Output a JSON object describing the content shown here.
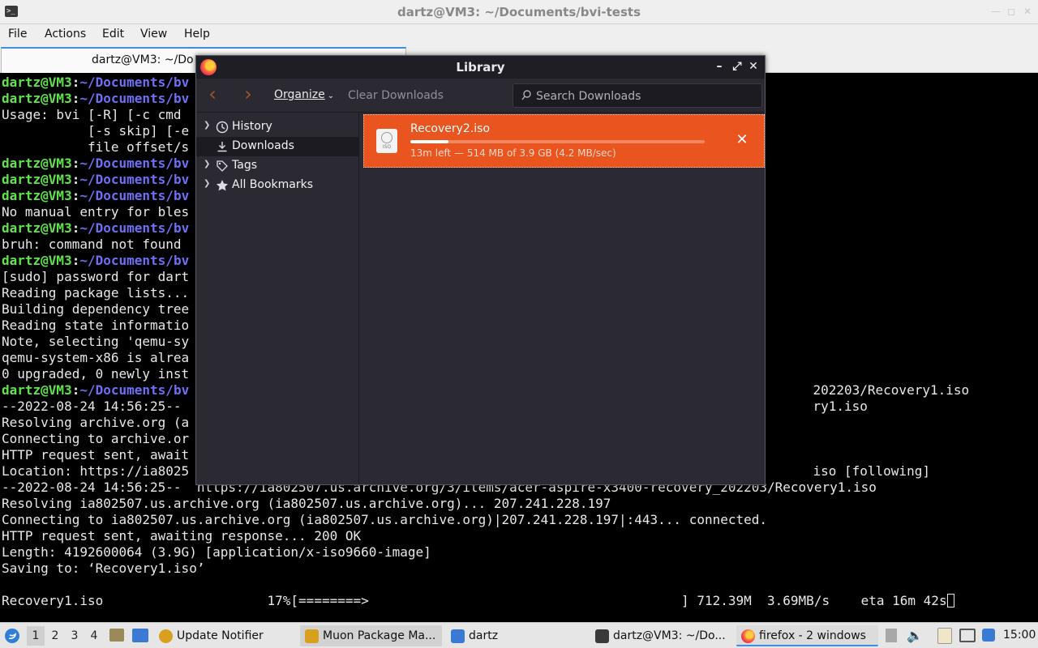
{
  "terminal": {
    "title": "dartz@VM3: ~/Documents/bvi-tests",
    "menu": [
      "File",
      "Actions",
      "Edit",
      "View",
      "Help"
    ],
    "tab_title": "dartz@VM3: ~/Do",
    "prompt_user": "dartz@VM3",
    "prompt_path": "~/Documents/bv",
    "lines": [
      {
        "t": "prompt"
      },
      {
        "t": "prompt"
      },
      {
        "t": "text",
        "s": "Usage: bvi [-R] [-c cmd"
      },
      {
        "t": "text",
        "s": "           [-s skip] [-e"
      },
      {
        "t": "text",
        "s": "           file offset/s"
      },
      {
        "t": "prompt"
      },
      {
        "t": "prompt"
      },
      {
        "t": "prompt"
      },
      {
        "t": "text",
        "s": "No manual entry for bles"
      },
      {
        "t": "prompt"
      },
      {
        "t": "text",
        "s": "bruh: command not found"
      },
      {
        "t": "prompt"
      },
      {
        "t": "text",
        "s": "[sudo] password for dart"
      },
      {
        "t": "text",
        "s": "Reading package lists..."
      },
      {
        "t": "text",
        "s": "Building dependency tree"
      },
      {
        "t": "text",
        "s": "Reading state informatio"
      },
      {
        "t": "text",
        "s": "Note, selecting 'qemu-sy"
      },
      {
        "t": "text",
        "s": "qemu-system-x86 is alrea"
      },
      {
        "t": "text",
        "s": "0 upgraded, 0 newly inst"
      },
      {
        "t": "prompt"
      },
      {
        "t": "text",
        "s": "--2022-08-24 14:56:25-- "
      },
      {
        "t": "text",
        "s": "Resolving archive.org (a"
      },
      {
        "t": "text",
        "s": "Connecting to archive.or"
      },
      {
        "t": "text",
        "s": "HTTP request sent, await"
      },
      {
        "t": "text",
        "s": "Location: https://ia8025"
      },
      {
        "t": "text",
        "s": "--2022-08-24 14:56:25--  https://ia802507.us.archive.org/3/items/acer-aspire-x3400-recovery_202203/Recovery1.iso"
      },
      {
        "t": "text",
        "s": "Resolving ia802507.us.archive.org (ia802507.us.archive.org)... 207.241.228.197"
      },
      {
        "t": "text",
        "s": "Connecting to ia802507.us.archive.org (ia802507.us.archive.org)|207.241.228.197|:443... connected."
      },
      {
        "t": "text",
        "s": "HTTP request sent, awaiting response... 200 OK"
      },
      {
        "t": "text",
        "s": "Length: 4192600064 (3.9G) [application/x-iso9660-image]"
      },
      {
        "t": "text",
        "s": "Saving to: ‘Recovery1.iso’"
      },
      {
        "t": "text",
        "s": ""
      },
      {
        "t": "progress",
        "s": "Recovery1.iso                     17%[========>                                        ] 712.39M  3.69MB/s    eta 16m 42s"
      }
    ],
    "right_fragments": [
      {
        "row": 19,
        "col": 104,
        "s": "202203/Recovery1.iso"
      },
      {
        "row": 20,
        "col": 104,
        "s": "ry1.iso"
      },
      {
        "row": 24,
        "col": 104,
        "s": "iso [following]"
      }
    ]
  },
  "library": {
    "title": "Library",
    "organize_label": "Organize",
    "clear_label": "Clear Downloads",
    "search_placeholder": "Search Downloads",
    "sidebar": [
      {
        "label": "History",
        "icon": "clock-icon",
        "expandable": true,
        "selected": false
      },
      {
        "label": "Downloads",
        "icon": "download-icon",
        "expandable": false,
        "selected": true
      },
      {
        "label": "Tags",
        "icon": "tag-icon",
        "expandable": true,
        "selected": false
      },
      {
        "label": "All Bookmarks",
        "icon": "star-icon",
        "expandable": true,
        "selected": false
      }
    ],
    "download": {
      "file_name": "Recovery2.iso",
      "file_icon_label": "ISO",
      "status": "13m left — 514 MB of 3.9 GB (4.2 MB/sec)",
      "progress": 0.13,
      "accent": "#e9541f"
    }
  },
  "taskbar": {
    "workspaces": [
      "1",
      "2",
      "3",
      "4"
    ],
    "current_workspace": "1",
    "items": [
      {
        "label": "Update Notifier",
        "icon": "update-notifier-icon"
      },
      {
        "label": "Muon Package Ma...",
        "icon": "muon-icon"
      },
      {
        "label": "dartz",
        "icon": "folder-icon"
      },
      {
        "label": "dartz@VM3: ~/Do...",
        "icon": "terminal-icon"
      },
      {
        "label": "firefox - 2 windows",
        "icon": "firefox-icon"
      }
    ],
    "clock": "15:00"
  }
}
